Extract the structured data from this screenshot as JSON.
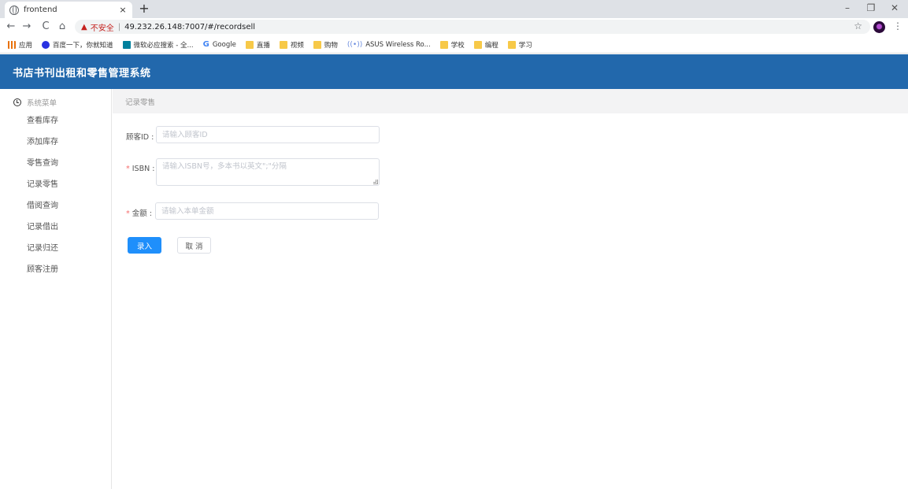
{
  "browser": {
    "tab_title": "frontend",
    "tab_close": "×",
    "new_tab": "+",
    "window_controls": [
      "–",
      "❐",
      "✕"
    ],
    "nav_back": "←",
    "nav_forward": "→",
    "nav_reload": "C",
    "nav_home": "⌂",
    "security_icon": "▲",
    "security_text": "不安全",
    "url": "49.232.26.148:7007/#/recordsell",
    "bookmark_star": "☆",
    "menu_kebab": "⋮",
    "bookmarks": [
      {
        "label": "应用",
        "icon": "apps-icon"
      },
      {
        "label": "百度一下，你就知道",
        "icon": "baidu-icon"
      },
      {
        "label": "微软必应搜索 - 全...",
        "icon": "bing-icon"
      },
      {
        "label": "Google",
        "icon": "google-icon"
      },
      {
        "label": "直播",
        "icon": "folder-icon"
      },
      {
        "label": "视频",
        "icon": "folder-icon"
      },
      {
        "label": "购物",
        "icon": "folder-icon"
      },
      {
        "label": "ASUS Wireless Ro...",
        "icon": "wifi-icon"
      },
      {
        "label": "学校",
        "icon": "folder-icon"
      },
      {
        "label": "编程",
        "icon": "folder-icon"
      },
      {
        "label": "学习",
        "icon": "folder-icon"
      }
    ]
  },
  "app": {
    "title": "书店书刊出租和零售管理系统",
    "header_color": "#2268ac"
  },
  "sidebar": {
    "group_label": "系统菜单",
    "items": [
      {
        "label": "查看库存"
      },
      {
        "label": "添加库存"
      },
      {
        "label": "零售查询"
      },
      {
        "label": "记录零售"
      },
      {
        "label": "借阅查询"
      },
      {
        "label": "记录借出"
      },
      {
        "label": "记录归还"
      },
      {
        "label": "顾客注册"
      }
    ]
  },
  "breadcrumb": {
    "current": "记录零售"
  },
  "form": {
    "customer_id": {
      "label": "顾客ID :",
      "value": "",
      "placeholder": "请输入顾客ID",
      "required": false
    },
    "isbn": {
      "label": "ISBN :",
      "value": "",
      "placeholder": "请输入ISBN号，多本书以英文\";\"分隔",
      "required": true
    },
    "amount": {
      "label": "金额 :",
      "value": "",
      "placeholder": "请输入本单金额",
      "required": true
    },
    "required_mark": "*",
    "submit_label": "录入",
    "cancel_label": "取 消",
    "primary_color": "#1f8ffb"
  }
}
